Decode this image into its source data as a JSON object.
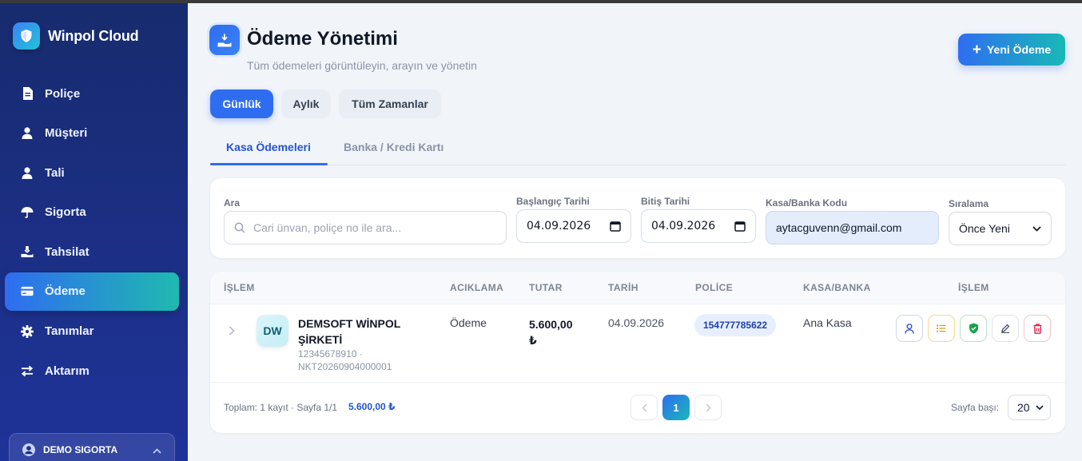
{
  "app": {
    "name": "Winpol Cloud"
  },
  "sidebar": {
    "items": [
      {
        "label": "Poliçe",
        "icon": "document-icon"
      },
      {
        "label": "Müşteri",
        "icon": "user-icon"
      },
      {
        "label": "Tali",
        "icon": "user-icon"
      },
      {
        "label": "Sigorta",
        "icon": "umbrella-icon"
      },
      {
        "label": "Tahsilat",
        "icon": "hand-coin-icon"
      },
      {
        "label": "Ödeme",
        "icon": "credit-card-icon",
        "active": true
      },
      {
        "label": "Tanımlar",
        "icon": "gear-icon"
      },
      {
        "label": "Aktarım",
        "icon": "transfer-icon"
      }
    ],
    "user": {
      "name": "DEMO SIGORTA"
    }
  },
  "header": {
    "title": "Ödeme Yönetimi",
    "subtitle": "Tüm ödemeleri görüntüleyin, arayın ve yönetin",
    "new_button": "Yeni Ödeme"
  },
  "periods": [
    {
      "label": "Günlük",
      "active": true
    },
    {
      "label": "Aylık",
      "active": false
    },
    {
      "label": "Tüm Zamanlar",
      "active": false
    }
  ],
  "tabs": [
    {
      "label": "Kasa Ödemeleri",
      "active": true
    },
    {
      "label": "Banka / Kredi Kartı",
      "active": false
    }
  ],
  "filters": {
    "search": {
      "label": "Ara",
      "placeholder": "Cari ünvan, poliçe no ile ara..."
    },
    "start_date": {
      "label": "Başlangıç Tarihi",
      "value": "04.09.2026"
    },
    "end_date": {
      "label": "Bitiş Tarihi",
      "value": "04.09.2026"
    },
    "code": {
      "label": "Kasa/Banka Kodu",
      "value": "aytacguvenn@gmail.com"
    },
    "sort": {
      "label": "Sıralama",
      "value": "Önce Yeni"
    }
  },
  "table": {
    "columns": [
      "İŞLEM",
      "ACIKLAMA",
      "TUTAR",
      "TARİH",
      "POLİCE",
      "KASA/BANKA",
      "İŞLEM"
    ],
    "rows": [
      {
        "initials": "DW",
        "name": "DEMSOFT WİNPOL ŞİRKETİ",
        "meta_line1": "12345678910 ·",
        "meta_line2": "NKT20260904000001",
        "description": "Ödeme",
        "amount_value": "5.600,00",
        "amount_currency": "₺",
        "date": "04.09.2026",
        "police": "154777785622",
        "cash_bank": "Ana Kasa"
      }
    ],
    "footer": {
      "summary": "Toplam: 1 kayıt · Sayfa 1/1",
      "total": "5.600,00 ₺",
      "current_page": "1",
      "per_page_label": "Sayfa başı:",
      "per_page": "20"
    }
  },
  "colors": {
    "accent": "#2f6df0",
    "accent_teal": "#18b9b6",
    "sidebar_bg": "#1c2f86"
  }
}
